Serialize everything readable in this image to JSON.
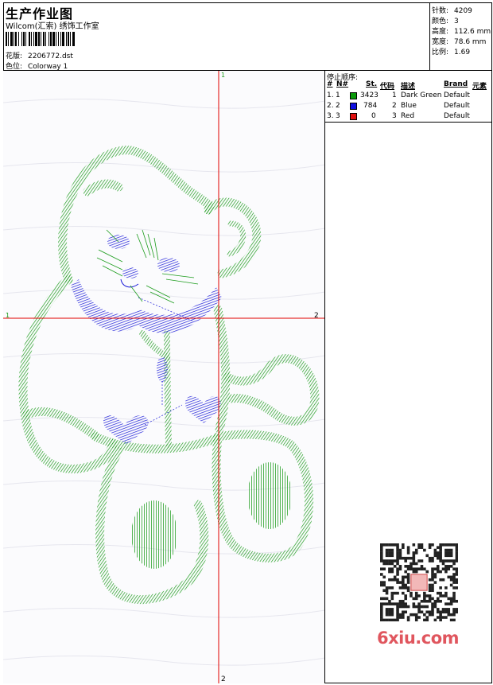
{
  "header": {
    "title": "生产作业图",
    "studio": "Wilcom(汇索) 绣饰工作室",
    "file_label": "花版:",
    "file_value": "2206772.dst",
    "colorway_label": "色位:",
    "colorway_value": "Colorway 1"
  },
  "stats": {
    "stitches_label": "针数:",
    "stitches_value": "4209",
    "colors_label": "颜色:",
    "colors_value": "3",
    "height_label": "高度:",
    "height_value": "112.6 mm",
    "width_label": "宽度:",
    "width_value": "78.6 mm",
    "scale_label": "比例:",
    "scale_value": "1.69"
  },
  "color_table": {
    "caption": "停止顺序:",
    "headers": {
      "num": "#",
      "no": "N#",
      "st": "St.",
      "code": "代码",
      "desc": "描述",
      "brand": "Brand",
      "chart": "元素"
    },
    "rows": [
      {
        "num": "1.",
        "no": "1",
        "color": "#0a9a0a",
        "st": "3423",
        "code": "1",
        "desc": "Dark Green",
        "brand": "Default"
      },
      {
        "num": "2.",
        "no": "2",
        "color": "#1010e0",
        "st": "784",
        "code": "2",
        "desc": "Blue",
        "brand": "Default"
      },
      {
        "num": "3.",
        "no": "3",
        "color": "#e01010",
        "st": "0",
        "code": "3",
        "desc": "Red",
        "brand": "Default"
      }
    ]
  },
  "crosshair": {
    "label_top": "1",
    "label_bottom": "2",
    "label_left": "1",
    "label_right": "2"
  },
  "watermark": "6xiu.com",
  "colors": {
    "green": "#1c9c1c",
    "blue": "#1a1ad8",
    "red": "#e01010",
    "crosshair": "#e00000"
  }
}
